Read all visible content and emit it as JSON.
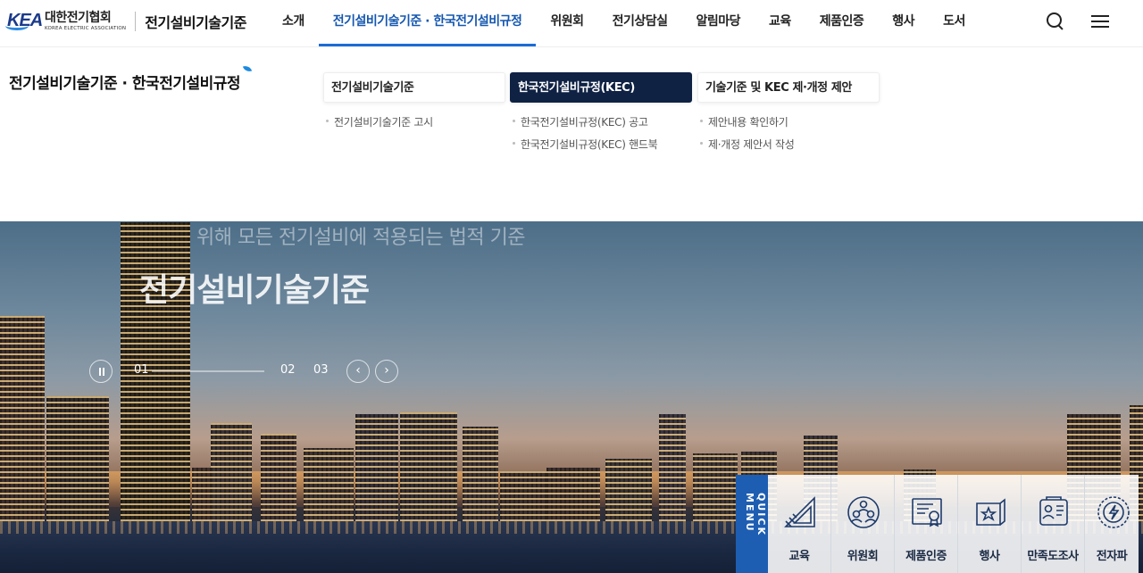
{
  "header": {
    "logo_kr": "대한전기협회",
    "logo_en": "KOREA ELECTRIC ASSOCIATION",
    "logo_mark": "KEA",
    "site_name": "전기설비기술기준",
    "nav": [
      "소개",
      "전기설비기술기준 · 한국전기설비규정",
      "위원회",
      "전기상담실",
      "알림마당",
      "교육",
      "제품인증",
      "행사",
      "도서"
    ],
    "active_index": 1,
    "icons": [
      "search-icon",
      "menu-icon"
    ]
  },
  "dropdown": {
    "title": "전기설비기술기준 · 한국전기설비규정",
    "columns": [
      {
        "label": "전기설비기술기준",
        "selected": false,
        "items": [
          "전기설비기술기준 고시"
        ]
      },
      {
        "label": "한국전기설비규정(KEC)",
        "selected": true,
        "items": [
          "한국전기설비규정(KEC) 공고",
          "한국전기설비규정(KEC) 핸드북"
        ]
      },
      {
        "label": "기술기준 및 KEC 제·개정 제안",
        "selected": false,
        "items": [
          "제안내용 확인하기",
          "제·개정 제안서 작성"
        ]
      }
    ]
  },
  "hero": {
    "subtitle": "위해 모든 전기설비에 적용되는 법적 기준",
    "title": "전기설비기술기준",
    "pager": {
      "current": "01",
      "pages": [
        "01",
        "02",
        "03"
      ],
      "progress": 0
    },
    "prev_glyph": "‹",
    "next_glyph": "›"
  },
  "quick_menu": {
    "label": "QUICK MENU",
    "items": [
      {
        "label": "교육",
        "icon": "ruler-triangle-icon"
      },
      {
        "label": "위원회",
        "icon": "committee-people-icon"
      },
      {
        "label": "제품인증",
        "icon": "certificate-icon"
      },
      {
        "label": "행사",
        "icon": "event-banner-icon"
      },
      {
        "label": "만족도조사",
        "icon": "survey-icon"
      },
      {
        "label": "전자파",
        "icon": "emf-icon"
      }
    ]
  },
  "colors": {
    "accent": "#1c6cd6",
    "selected_tab_bg": "#0f2244",
    "quick_label_bg": "#1e5eb2"
  }
}
